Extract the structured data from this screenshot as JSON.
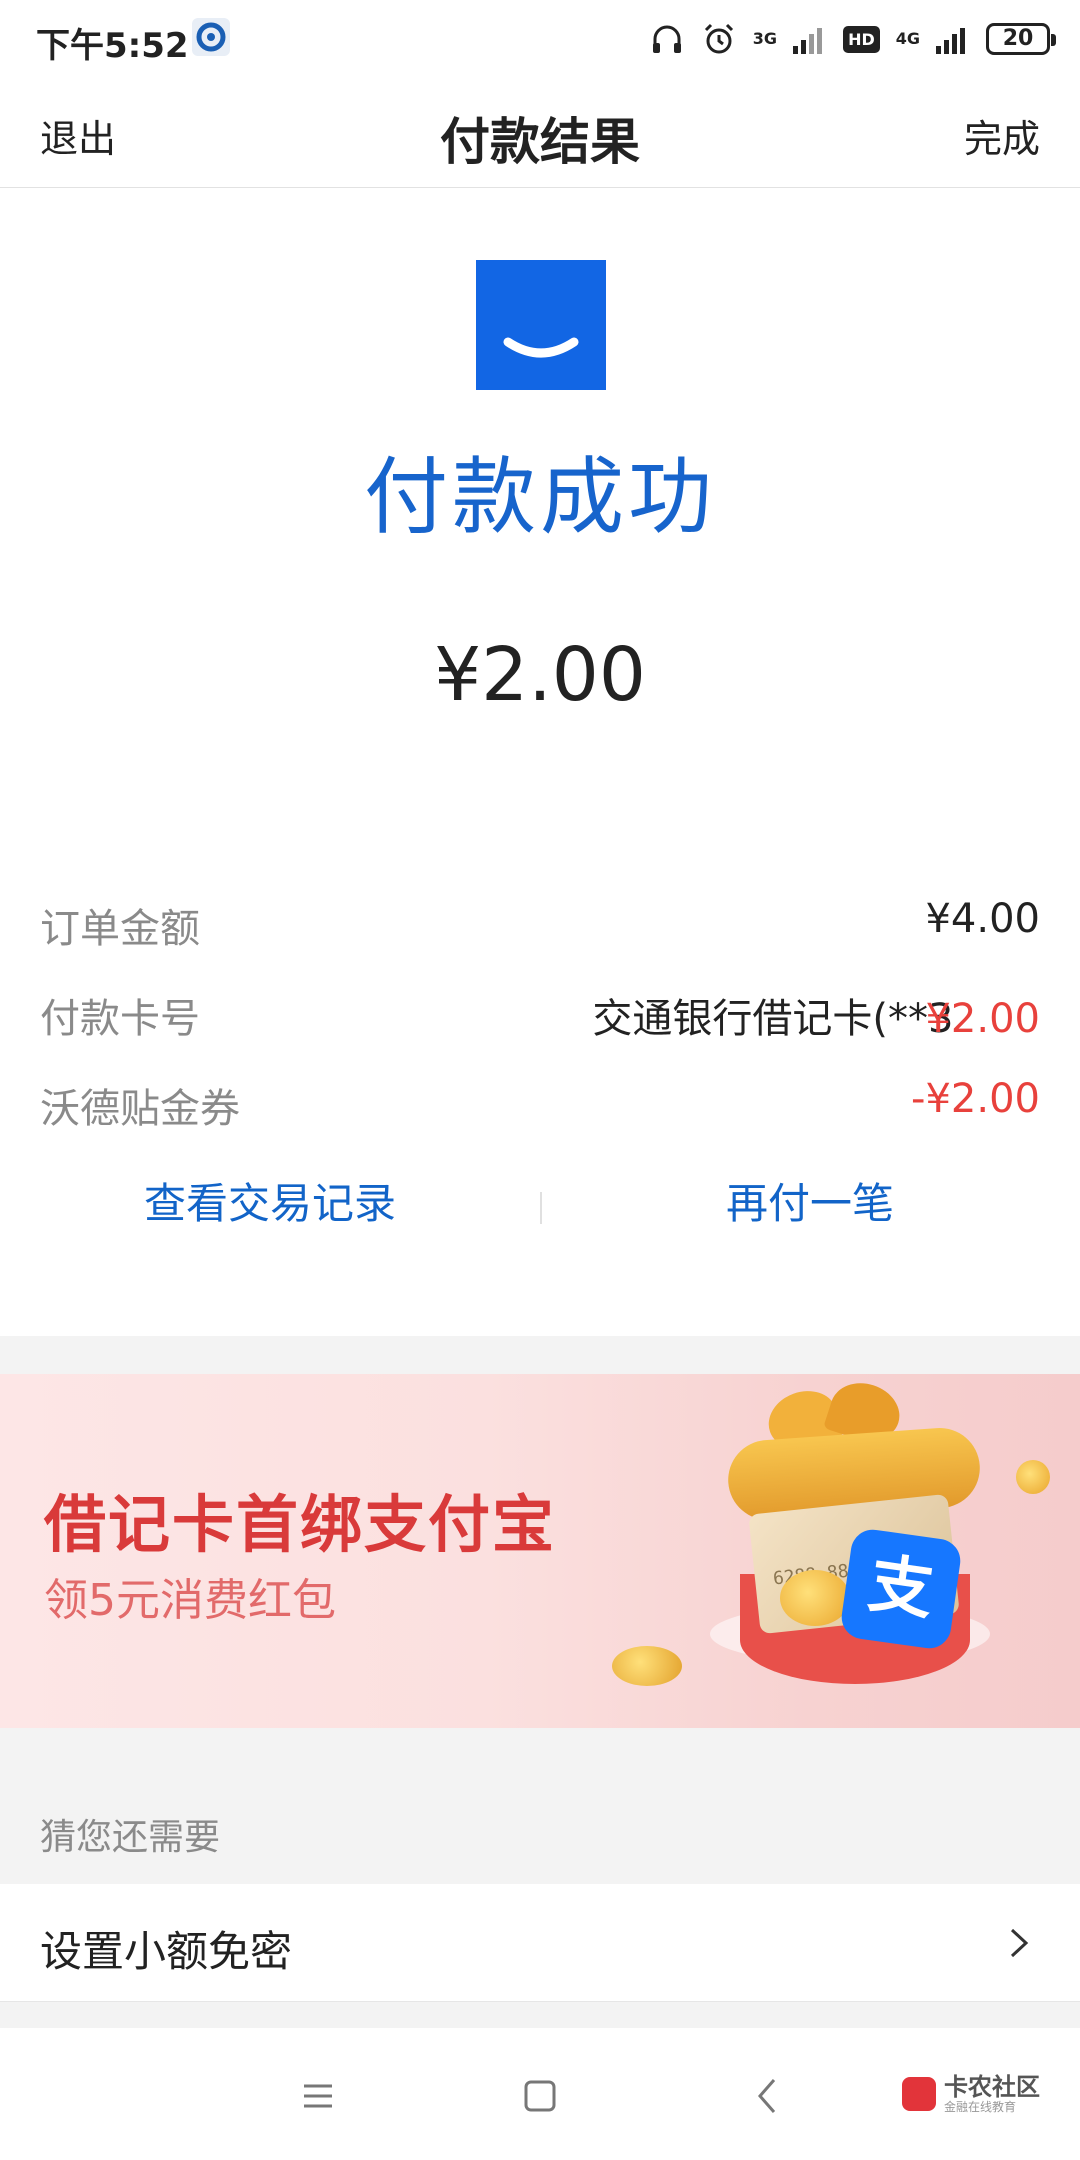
{
  "status_bar": {
    "time": "下午5:52",
    "network_3g": "3G",
    "network_4g": "4G",
    "hd": "HD",
    "battery": "20"
  },
  "navbar": {
    "left": "退出",
    "title": "付款结果",
    "right": "完成"
  },
  "result": {
    "status": "付款成功",
    "amount": "¥2.00"
  },
  "details": [
    {
      "label": "订单金额",
      "value": "¥4.00"
    },
    {
      "label": "付款卡号",
      "value": "交通银行借记卡(**3",
      "value_overlap": "¥2.00"
    },
    {
      "label": "沃德贴金券",
      "value": "-¥2.00"
    }
  ],
  "actions": {
    "view_records": "查看交易记录",
    "pay_again": "再付一笔"
  },
  "banner": {
    "title": "借记卡首绑支付宝",
    "subtitle": "领5元消费红包",
    "card_number": "6288 8888",
    "alipay_glyph": "支"
  },
  "suggestions": {
    "header": "猜您还需要",
    "items": [
      {
        "label": "设置小额免密"
      }
    ]
  },
  "watermark": {
    "name": "卡农社区",
    "tagline": "金融在线教育"
  },
  "colors": {
    "brand_blue": "#1266e4",
    "link_blue": "#1264c8",
    "negative_red": "#e8413c",
    "banner_red": "#d93a3a"
  }
}
